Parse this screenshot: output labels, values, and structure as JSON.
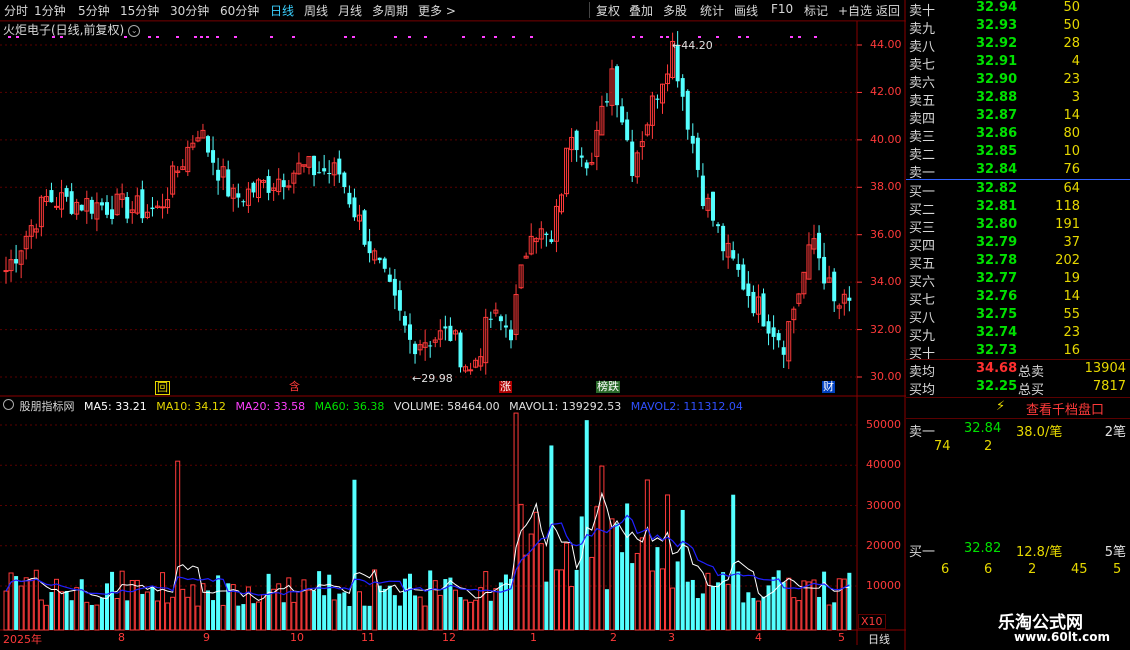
{
  "toolbar": {
    "periods": [
      "分时",
      "1分钟",
      "5分钟",
      "15分钟",
      "30分钟",
      "60分钟",
      "日线",
      "周线",
      "月线",
      "多周期",
      "更多 >"
    ],
    "active_period": "日线",
    "actions": [
      "复权",
      "叠加",
      "多股",
      "统计",
      "画线",
      "F10",
      "标记",
      "+自选",
      "返回"
    ]
  },
  "chart_title": "火炬电子(日线,前复权)",
  "price_axis": [
    "44.00",
    "42.00",
    "40.00",
    "38.00",
    "36.00",
    "34.00",
    "32.00",
    "30.00"
  ],
  "price_high_label": "44.20",
  "price_low_label": "29.98",
  "event_markers": [
    "回",
    "含",
    "涨",
    "榜跌",
    "财"
  ],
  "indicator": {
    "name": "股朋指标网",
    "ma5": "MA5: 33.21",
    "ma10": "MA10: 34.12",
    "ma20": "MA20: 33.58",
    "ma60": "MA60: 36.38",
    "volume": "VOLUME: 58464.00",
    "mavol1": "MAVOL1: 139292.53",
    "mavol2": "MAVOL2: 111312.04"
  },
  "volume_axis": [
    "50000",
    "40000",
    "30000",
    "20000",
    "10000"
  ],
  "volume_unit": "X10",
  "date_axis": {
    "year": "2025年",
    "months": [
      "8",
      "9",
      "10",
      "11",
      "12",
      "1",
      "2",
      "3",
      "4",
      "5"
    ],
    "period_label": "日线"
  },
  "order_book": {
    "sells": [
      {
        "label": "卖十",
        "price": "32.94",
        "vol": "50"
      },
      {
        "label": "卖九",
        "price": "32.93",
        "vol": "50"
      },
      {
        "label": "卖八",
        "price": "32.92",
        "vol": "28"
      },
      {
        "label": "卖七",
        "price": "32.91",
        "vol": "4"
      },
      {
        "label": "卖六",
        "price": "32.90",
        "vol": "23"
      },
      {
        "label": "卖五",
        "price": "32.88",
        "vol": "3"
      },
      {
        "label": "卖四",
        "price": "32.87",
        "vol": "14"
      },
      {
        "label": "卖三",
        "price": "32.86",
        "vol": "80"
      },
      {
        "label": "卖二",
        "price": "32.85",
        "vol": "10"
      },
      {
        "label": "卖一",
        "price": "32.84",
        "vol": "76"
      }
    ],
    "buys": [
      {
        "label": "买一",
        "price": "32.82",
        "vol": "64"
      },
      {
        "label": "买二",
        "price": "32.81",
        "vol": "118"
      },
      {
        "label": "买三",
        "price": "32.80",
        "vol": "191"
      },
      {
        "label": "买四",
        "price": "32.79",
        "vol": "37"
      },
      {
        "label": "买五",
        "price": "32.78",
        "vol": "202"
      },
      {
        "label": "买六",
        "price": "32.77",
        "vol": "19"
      },
      {
        "label": "买七",
        "price": "32.76",
        "vol": "14"
      },
      {
        "label": "买八",
        "price": "32.75",
        "vol": "55"
      },
      {
        "label": "买九",
        "price": "32.74",
        "vol": "23"
      },
      {
        "label": "买十",
        "price": "32.73",
        "vol": "16"
      }
    ],
    "sell_avg_label": "卖均",
    "sell_avg": "34.68",
    "total_sell_label": "总卖",
    "total_sell": "13904",
    "buy_avg_label": "买均",
    "buy_avg": "32.25",
    "total_buy_label": "总买",
    "total_buy": "7817",
    "ten_level_link": "查看千档盘口",
    "ask1_label": "卖一",
    "ask1_price": "32.84",
    "ask1_size": "38.0/笔",
    "ask1_count": "2笔",
    "ask1_orders": [
      "74",
      "2"
    ],
    "bid1_label": "买一",
    "bid1_price": "32.82",
    "bid1_size": "12.8/笔",
    "bid1_count": "5笔",
    "bid1_orders": [
      "6",
      "6",
      "2",
      "45",
      "5"
    ]
  },
  "watermark": {
    "name": "乐淘公式网",
    "url": "www.60lt.com"
  },
  "colors": {
    "up": "#ff3a3a",
    "down": "#54ffff",
    "ma5": "#ffffff",
    "ma10": "#e6d800",
    "ma20": "#ff40ff",
    "ma60": "#00e000",
    "mavol2": "#2020ff",
    "grid": "#5a0000"
  }
}
